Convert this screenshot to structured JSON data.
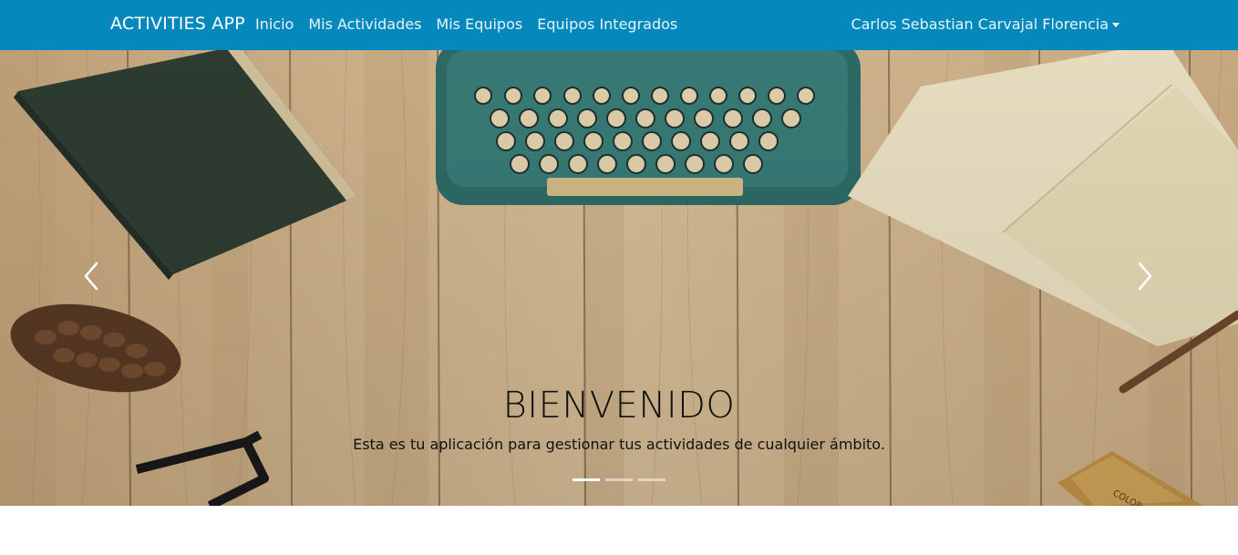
{
  "navbar": {
    "brand": "ACTIVITIES APP",
    "links": [
      "Inicio",
      "Mis Actividades",
      "Mis Equipos",
      "Equipos Integrados"
    ],
    "user_name": "Carlos Sebastian Carvajal Florencia",
    "background": "#0589bd"
  },
  "carousel": {
    "slide_image": "wooden desk with typewriter, book, notebook, pinecone and glasses",
    "prev_icon": "chevron-left-icon",
    "next_icon": "chevron-right-icon",
    "caption": {
      "title": "BIENVENIDO",
      "text": "Esta es tu aplicación para gestionar tus actividades de cualquier ámbito."
    },
    "indicators": {
      "count": 3,
      "active_index": 0
    }
  }
}
